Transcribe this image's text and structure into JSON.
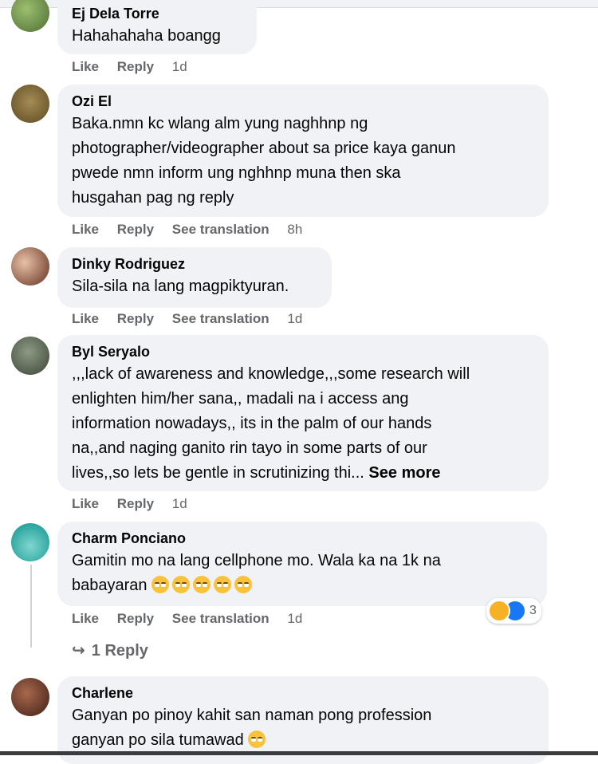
{
  "comments": [
    {
      "author": "Ej Dela Torre",
      "lines": [
        "Hahahahaha boangg"
      ],
      "actions": {
        "like": "Like",
        "reply": "Reply",
        "time": "1d"
      },
      "avatar_color": "#6a8d4f"
    },
    {
      "author": "Ozi El",
      "lines": [
        "Baka.nmn kc wlang alm yung naghhnp ng",
        "photographer/videographer about sa price kaya ganun",
        "pwede nmn inform ung nghhnp muna then ska",
        "husgahan pag ng reply"
      ],
      "actions": {
        "like": "Like",
        "reply": "Reply",
        "translate": "See translation",
        "time": "8h"
      },
      "avatar_color": "#7a6a3a"
    },
    {
      "author": "Dinky Rodriguez",
      "lines": [
        "Sila-sila na lang magpiktyuran."
      ],
      "actions": {
        "like": "Like",
        "reply": "Reply",
        "translate": "See translation",
        "time": "1d"
      },
      "avatar_color": "#a77b6a"
    },
    {
      "author": "Byl Seryalo",
      "lines": [
        ",,,lack of awareness and knowledge,,,some research will",
        "enlighten him/her sana,, madali na i access ang",
        "information nowadays,, its in the palm of our hands",
        "na,,and naging ganito rin tayo in some parts of our",
        "lives,,so lets be gentle in scrutinizing thi..."
      ],
      "see_more": "See more",
      "actions": {
        "like": "Like",
        "reply": "Reply",
        "time": "1d"
      },
      "avatar_color": "#4f5a4c"
    },
    {
      "author": "Charm Ponciano",
      "lines": [
        "Gamitin mo na lang cellphone mo. Wala ka na 1k na",
        "babayaran"
      ],
      "emoji_count": 5,
      "actions": {
        "like": "Like",
        "reply": "Reply",
        "translate": "See translation",
        "time": "1d"
      },
      "reactions": {
        "count": "3"
      },
      "replies_link": "1 Reply",
      "avatar_color": "#3fb8b1"
    },
    {
      "author": "Charlene",
      "lines": [
        "Ganyan po pinoy kahit san naman pong profession",
        "ganyan po sila tumawad"
      ],
      "avatar_color": "#6b3a2a"
    }
  ],
  "colors": {
    "bubble": "#f0f2f5",
    "secondary_text": "#65676b",
    "like_blue": "#1877f2",
    "haha_yellow": "#f7b125"
  },
  "icons": {
    "reply_arrow": "reply-arrow-icon"
  }
}
